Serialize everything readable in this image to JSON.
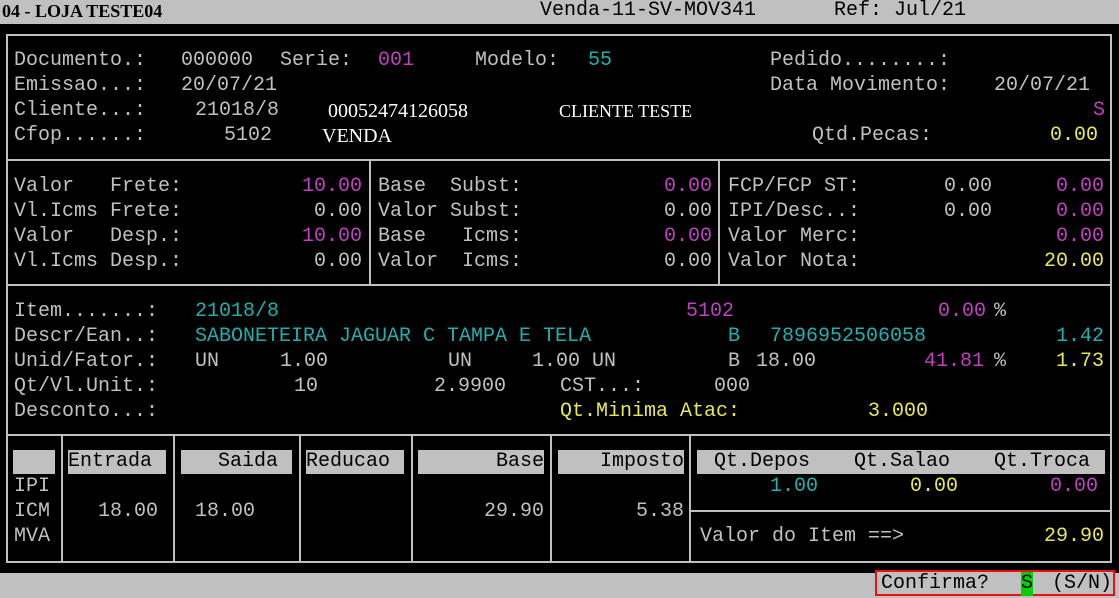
{
  "topbar": {
    "store": "04 - LOJA TESTE04",
    "screen": "Venda-11-SV-MOV341",
    "ref": "Ref: Jul/21"
  },
  "header": {
    "documento_label": "Documento.:",
    "documento": "000000",
    "serie_label": "Serie:",
    "serie": "001",
    "modelo_label": "Modelo:",
    "modelo": "55",
    "pedido_label": "Pedido........:",
    "emissao_label": "Emissao...:",
    "emissao": "20/07/21",
    "data_mov_label": "Data Movimento:",
    "data_mov": "20/07/21",
    "cliente_label": "Cliente...:",
    "cliente_code": "21018/8",
    "cliente_doc": "00052474126058",
    "cliente_name": "CLIENTE TESTE",
    "s_flag": "S",
    "cfop_label": "Cfop......:",
    "cfop": "5102",
    "cfop_desc": "VENDA",
    "qtd_pecas_label": "Qtd.Pecas:",
    "qtd_pecas": "0.00"
  },
  "totals": {
    "valor_frete_label": "Valor   Frete:",
    "valor_frete": "10.00",
    "vl_icms_frete_label": "Vl.Icms Frete:",
    "vl_icms_frete": "0.00",
    "valor_desp_label": "Valor   Desp.:",
    "valor_desp": "10.00",
    "vl_icms_desp_label": "Vl.Icms Desp.:",
    "vl_icms_desp": "0.00",
    "base_subst_label": "Base  Subst:",
    "base_subst": "0.00",
    "valor_subst_label": "Valor Subst:",
    "valor_subst": "0.00",
    "base_icms_label": "Base   Icms:",
    "base_icms": "0.00",
    "valor_icms_label": "Valor  Icms:",
    "valor_icms": "0.00",
    "fcp_label": "FCP/FCP ST:",
    "fcp_a": "0.00",
    "fcp_b": "0.00",
    "ipi_desc_label": "IPI/Desc..:",
    "ipi_desc_a": "0.00",
    "ipi_desc_b": "0.00",
    "valor_merc_label": "Valor Merc:",
    "valor_merc": "0.00",
    "valor_nota_label": "Valor Nota:",
    "valor_nota": "20.00"
  },
  "item": {
    "item_label": "Item.......:",
    "item_code": "21018/8",
    "item_cfop": "5102",
    "item_pct": "0.00",
    "item_pct_sign": "%",
    "descr_label": "Descr/Ean..:",
    "descr": "SABONETEIRA JAGUAR C TAMPA E TELA",
    "descr_flag": "B",
    "ean": "7896952506058",
    "descr_val": "1.42",
    "unid_label": "Unid/Fator.:",
    "unid1": "UN",
    "fator1": "1.00",
    "unid2": "UN",
    "fator2": "1.00 UN",
    "unid_flag": "B",
    "unid_val": "18.00",
    "unid_pct": "41.81",
    "unid_pct_sign": "%",
    "unid_val2": "1.73",
    "qt_label": "Qt/Vl.Unit.:",
    "qt": "10",
    "vl_unit": "2.9900",
    "cst_label": "CST...:",
    "cst": "000",
    "desconto_label": "Desconto...:",
    "qt_min_label": "Qt.Minima Atac:",
    "qt_min": "3.000"
  },
  "tax_table": {
    "headers": {
      "entrada": "Entrada",
      "saida": "Saida",
      "reducao": "Reducao",
      "base": "Base",
      "imposto": "Imposto"
    },
    "rows": [
      "IPI",
      "ICM",
      "MVA"
    ],
    "icm": {
      "entrada": "18.00",
      "saida": "18.00",
      "base": "29.90",
      "imposto": "5.38"
    }
  },
  "stock": {
    "qt_depos_label": "Qt.Depos",
    "qt_salao_label": "Qt.Salao",
    "qt_troca_label": "Qt.Troca",
    "qt_depos": "1.00",
    "qt_salao": "0.00",
    "qt_troca": "0.00",
    "valor_item_label": "Valor do Item ==>",
    "valor_item": "29.90"
  },
  "prompt": {
    "label": "Confirma?",
    "value": "S",
    "options": "(S/N)"
  }
}
